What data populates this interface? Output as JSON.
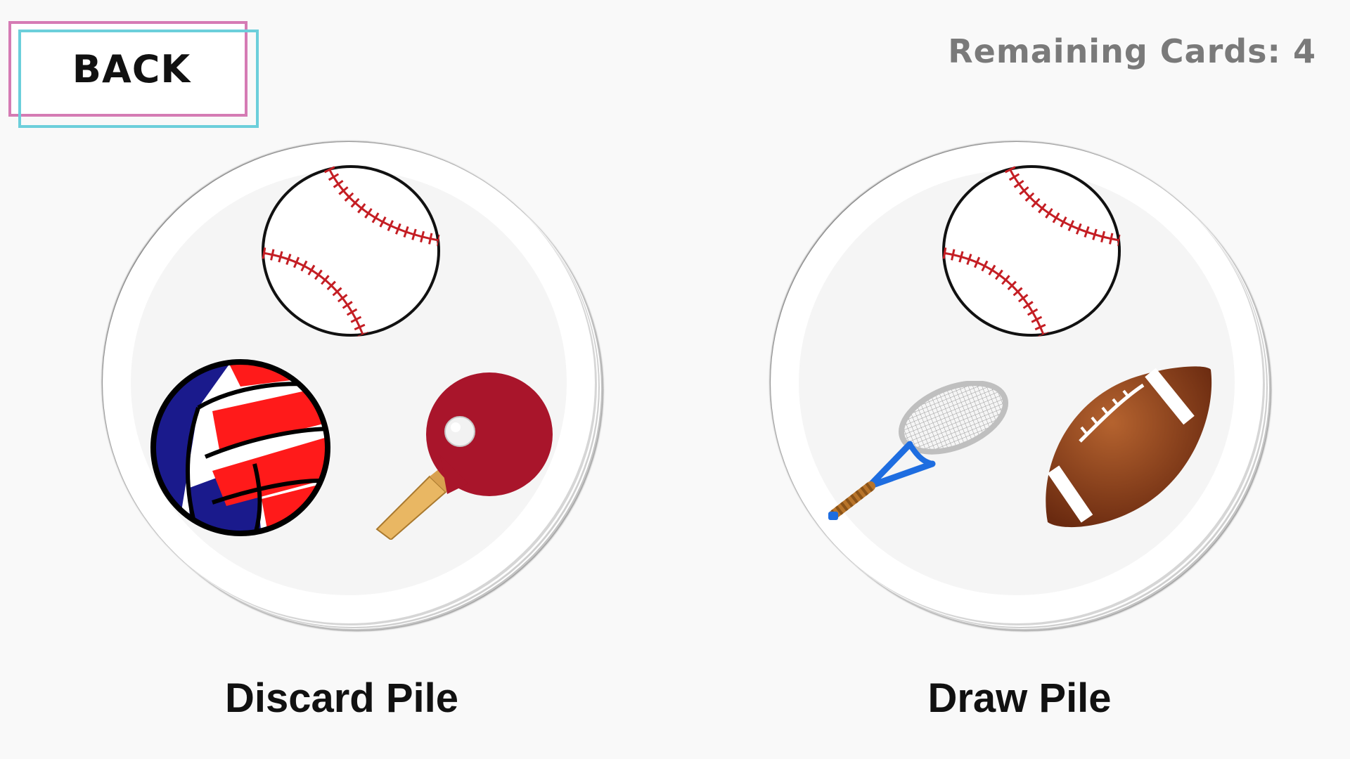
{
  "back_button": {
    "label": "BACK"
  },
  "status": {
    "remaining_label": "Remaining Cards:",
    "remaining_count": "4"
  },
  "piles": [
    {
      "label": "Discard Pile",
      "symbols": [
        "baseball-icon",
        "volleyball-icon",
        "ping-pong-paddle-icon"
      ]
    },
    {
      "label": "Draw Pile",
      "symbols": [
        "baseball-icon",
        "tennis-racket-icon",
        "football-icon"
      ]
    }
  ],
  "colors": {
    "background": "#f9f9f9",
    "back_border_pink": "#d57bb4",
    "back_border_cyan": "#6ccfdb",
    "remaining_text": "#7a7a7a"
  }
}
